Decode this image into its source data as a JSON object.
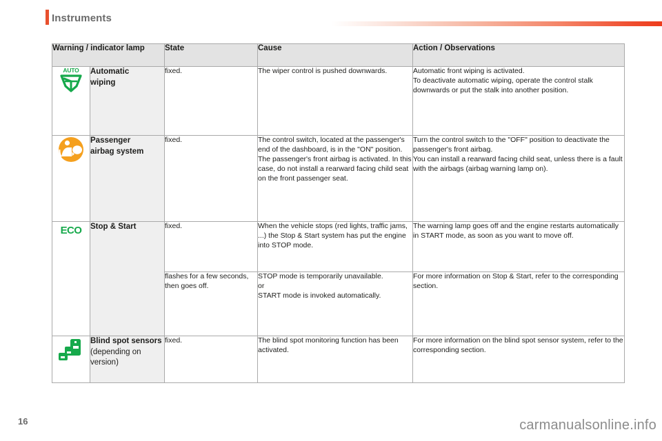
{
  "header": {
    "title": "Instruments",
    "accent_color": "#e8502e",
    "rule_gradient_from": "#ffffff",
    "rule_gradient_to": "#ed3c1c"
  },
  "table": {
    "columns": [
      "Warning / indicator lamp",
      "State",
      "Cause",
      "Action / Observations"
    ],
    "rows": [
      {
        "icon": "auto-wiper-icon",
        "icon_color": "#16a94b",
        "icon_label": "AUTO",
        "name_main": "Automatic",
        "name_main2": "wiping",
        "name_sub": "",
        "state": "fixed.",
        "cause": "The wiper control is pushed downwards.",
        "action_1": "Automatic front wiping is activated.",
        "action_2": "To deactivate automatic wiping, operate the control stalk downwards or put the stalk into another position."
      },
      {
        "icon": "passenger-airbag-icon",
        "icon_color": "#f5a01e",
        "icon_label": "",
        "name_main": "Passenger",
        "name_main2": "airbag system",
        "name_sub": "",
        "state": "fixed.",
        "cause": "The control switch, located at the passenger's end of the dashboard, is in the \"ON\" position.",
        "cause_2": "The passenger's front airbag is activated. In this case, do not install a rearward facing child seat on the front passenger seat.",
        "action_1": "Turn the control switch to the \"OFF\" position to deactivate the passenger's front airbag.",
        "action_2": "You can install a rearward facing child seat, unless there is a fault with the airbags (airbag warning lamp on)."
      },
      {
        "icon": "eco-icon",
        "icon_color": "#16a94b",
        "icon_label": "ECO",
        "name_main": "Stop & Start",
        "name_main2": "",
        "name_sub": "",
        "state": "fixed.",
        "cause": "When the vehicle stops (red lights, traffic jams, ...) the Stop & Start system has put the engine into STOP mode.",
        "action_1": "The warning lamp goes off and the engine restarts automatically in START mode, as soon as you want to move off."
      },
      {
        "icon": "",
        "icon_color": "",
        "icon_label": "",
        "name_main": "",
        "name_main2": "",
        "name_sub": "",
        "state": "flashes for a few seconds, then goes off.",
        "cause": "STOP mode is temporarily unavailable.",
        "cause_2": "or",
        "cause_3": "START mode is invoked automatically.",
        "action_1": "For more information on Stop & Start, refer to the corresponding section."
      },
      {
        "icon": "blind-spot-icon",
        "icon_color": "#16a94b",
        "icon_label": "",
        "name_main": "Blind spot sensors",
        "name_main2": "",
        "name_sub": "(depending on version)",
        "state": "fixed.",
        "cause": "The blind spot monitoring function has been activated.",
        "action_1": "For more information on the blind spot sensor system, refer to the corresponding section."
      }
    ]
  },
  "footer": {
    "page_number": "16",
    "watermark": "carmanualsonline.info"
  }
}
